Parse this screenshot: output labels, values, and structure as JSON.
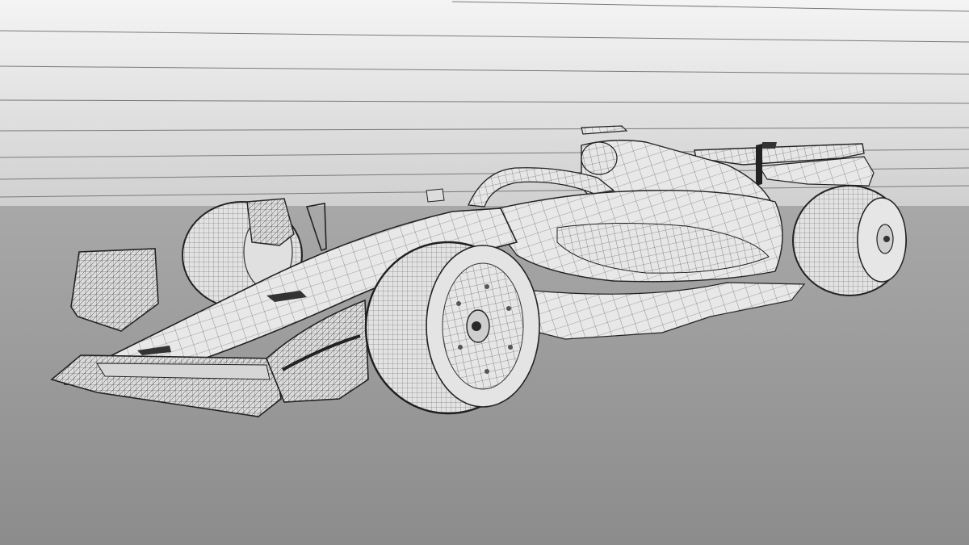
{
  "scene": {
    "subject": "f1-car-wireframe",
    "colors": {
      "backdrop_top": "#f4f4f4",
      "backdrop_bottom": "#cfcfcf",
      "floor_top": "#a8a8a8",
      "floor_bottom": "#8c8c8c",
      "surface": "#e6e6e6",
      "surface_shade": "#cfcfcf",
      "wire": "#2b2b2b",
      "wire_light": "#6a6a6a",
      "stripe": "#7a7a7a"
    }
  }
}
